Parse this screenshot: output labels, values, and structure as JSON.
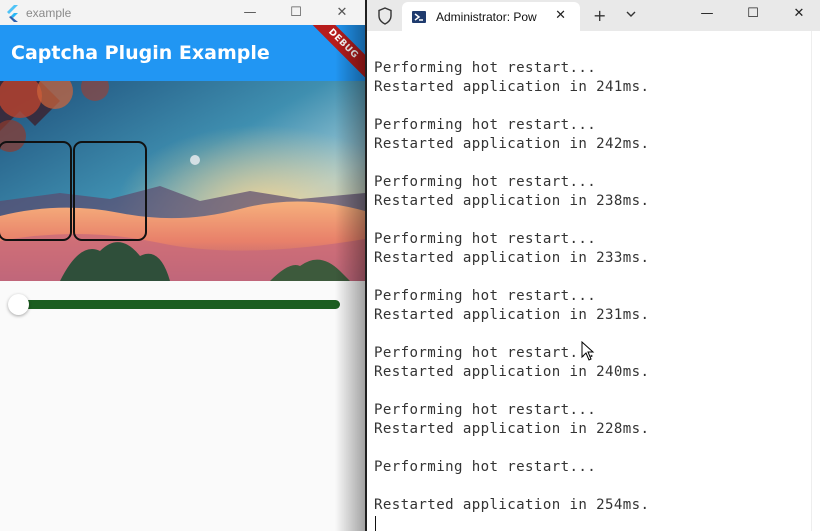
{
  "flutter_window": {
    "title": "example",
    "controls": {
      "minimize": "—",
      "maximize": "☐",
      "close": "✕"
    },
    "app_bar_title": "Captcha Plugin Example",
    "debug_banner": "DEBUG",
    "slider": {
      "value": 0.0
    }
  },
  "terminal_window": {
    "tab_title": "Administrator: Pow",
    "tab_close": "✕",
    "new_tab": "+",
    "controls": {
      "minimize": "—",
      "maximize": "☐",
      "close": "✕"
    },
    "lines": [
      "Performing hot restart...",
      "Restarted application in 241ms.",
      "",
      "Performing hot restart...",
      "Restarted application in 242ms.",
      "",
      "Performing hot restart...",
      "Restarted application in 238ms.",
      "",
      "Performing hot restart...",
      "Restarted application in 233ms.",
      "",
      "Performing hot restart...",
      "Restarted application in 231ms.",
      "",
      "Performing hot restart...",
      "Restarted application in 240ms.",
      "",
      "Performing hot restart...",
      "Restarted application in 228ms.",
      "",
      "Performing hot restart...",
      "",
      "Restarted application in 254ms."
    ]
  },
  "colors": {
    "app_bar": "#2196f3",
    "slider_track": "#1b5e20",
    "debug_banner": "#b71c1c"
  }
}
